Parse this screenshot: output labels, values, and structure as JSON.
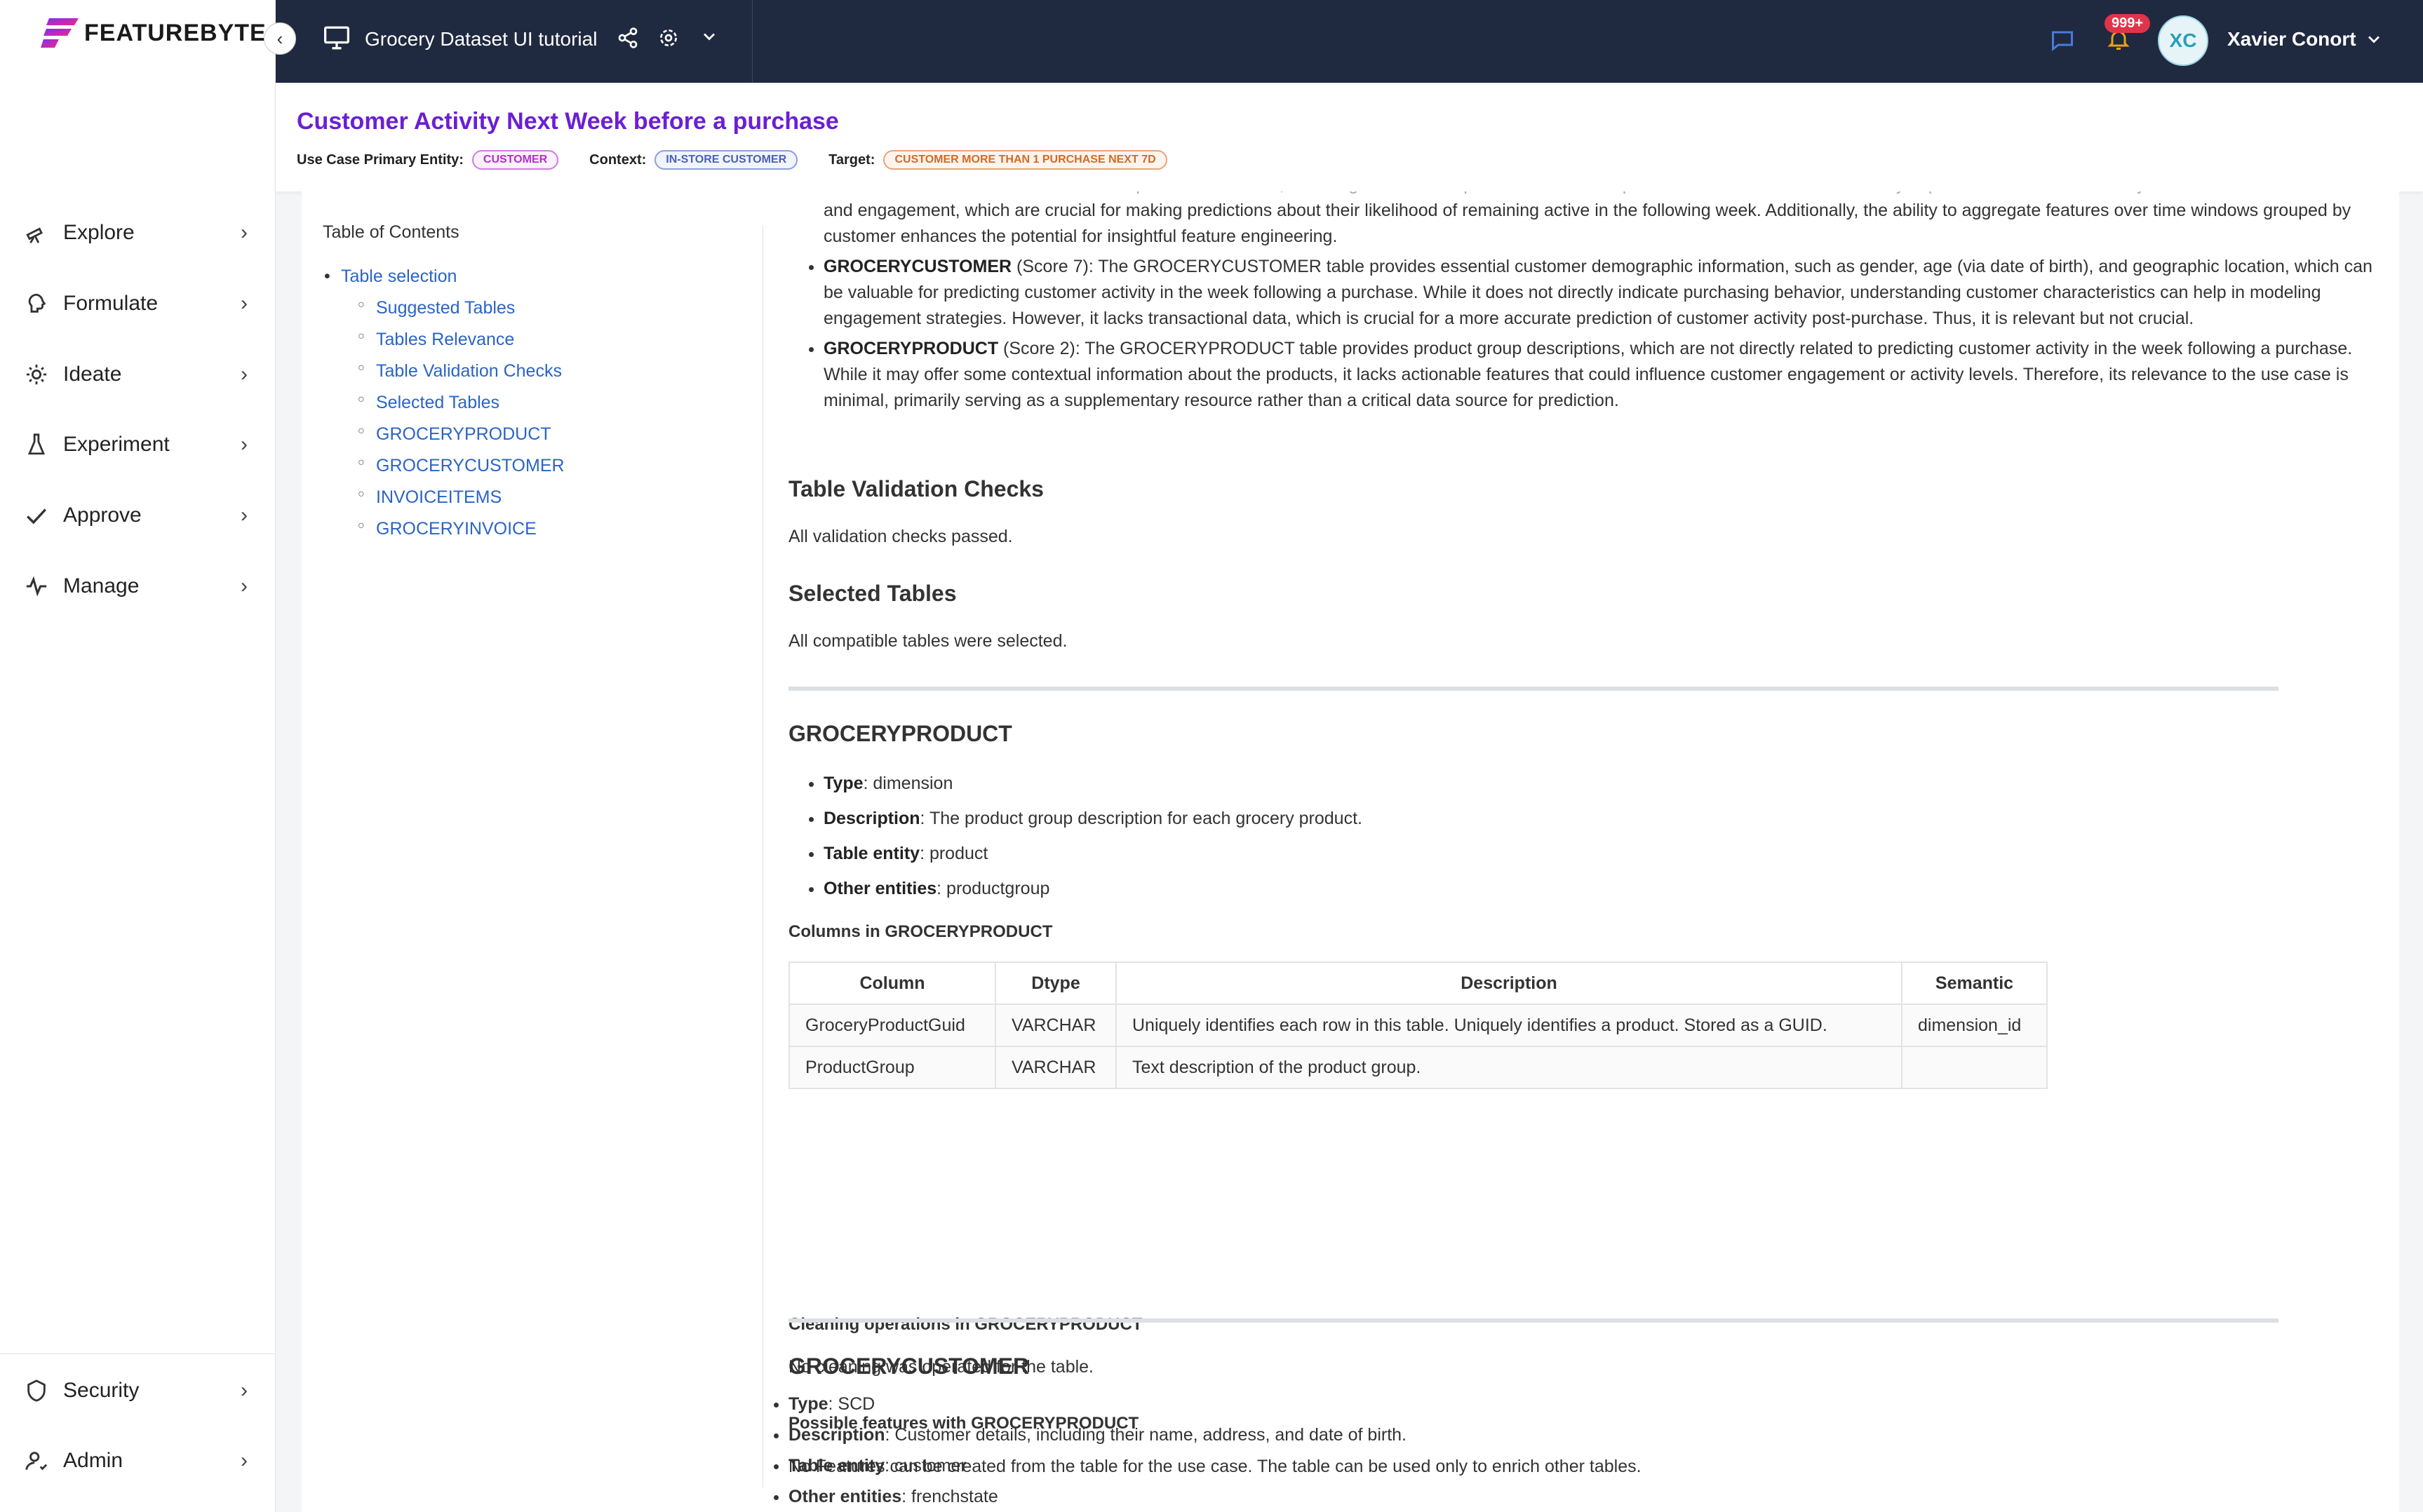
{
  "brand": {
    "name": "FEATUREBYTE"
  },
  "sidebar": {
    "items": [
      {
        "label": "Explore",
        "icon": "telescope-icon"
      },
      {
        "label": "Formulate",
        "icon": "brain-icon"
      },
      {
        "label": "Ideate",
        "icon": "lightbulb-icon"
      },
      {
        "label": "Experiment",
        "icon": "flask-icon"
      },
      {
        "label": "Approve",
        "icon": "check-icon"
      },
      {
        "label": "Manage",
        "icon": "pulse-icon"
      }
    ],
    "bottom_items": [
      {
        "label": "Security",
        "icon": "shield-icon"
      },
      {
        "label": "Admin",
        "icon": "user-admin-icon"
      }
    ]
  },
  "topbar": {
    "catalog_title": "Grocery Dataset UI tutorial",
    "notification_count": "999+",
    "user_initials": "XC",
    "user_name": "Xavier Conort"
  },
  "header": {
    "title": "Customer Activity Next Week before a purchase",
    "primary_entity_label": "Use Case Primary Entity:",
    "primary_entity_value": "CUSTOMER",
    "context_label": "Context:",
    "context_value": "IN-STORE CUSTOMER",
    "target_label": "Target:",
    "target_value": "CUSTOMER MORE THAN 1 PURCHASE NEXT 7D"
  },
  "toc": {
    "title": "Table of Contents",
    "top": "Table selection",
    "items": [
      "Suggested Tables",
      "Tables Relevance",
      "Table Validation Checks",
      "Selected Tables",
      "GROCERYPRODUCT",
      "GROCERYCUSTOMER",
      "INVOICEITEMS",
      "GROCERYINVOICE"
    ]
  },
  "doc": {
    "faded_line": "information about the customer's recent purchase behavior, including the timestamp and total amount spent. This data can be used to analyze patterns in customer activity",
    "para_cont": "and engagement, which are crucial for making predictions about their likelihood of remaining active in the following week. Additionally, the ability to aggregate features over time windows grouped by customer enhances the potential for insightful feature engineering.",
    "bullet_customer_name": "GROCERYCUSTOMER",
    "bullet_customer_text": " (Score 7): The GROCERYCUSTOMER table provides essential customer demographic information, such as gender, age (via date of birth), and geographic location, which can be valuable for predicting customer activity in the week following a purchase. While it does not directly indicate purchasing behavior, understanding customer characteristics can help in modeling engagement strategies. However, it lacks transactional data, which is crucial for a more accurate prediction of customer activity post-purchase. Thus, it is relevant but not crucial.",
    "bullet_product_name": "GROCERYPRODUCT",
    "bullet_product_text": " (Score 2): The GROCERYPRODUCT table provides product group descriptions, which are not directly related to predicting customer activity in the week following a purchase. While it may offer some contextual information about the products, it lacks actionable features that could influence customer engagement or activity levels. Therefore, its relevance to the use case is minimal, primarily serving as a supplementary resource rather than a critical data source for prediction.",
    "validation_heading": "Table Validation Checks",
    "validation_text": "All validation checks passed.",
    "selected_heading": "Selected Tables",
    "selected_text": "All compatible tables were selected.",
    "product": {
      "heading": "GROCERYPRODUCT",
      "type_label": "Type",
      "type_value": ": dimension",
      "desc_label": "Description",
      "desc_value": ": The product group description for each grocery product.",
      "entity_label": "Table entity",
      "entity_value": ": product",
      "other_label": "Other entities",
      "other_value": ": productgroup",
      "columns_heading": "Columns in GROCERYPRODUCT",
      "table_headers": [
        "Column",
        "Dtype",
        "Description",
        "Semantic"
      ],
      "rows": [
        [
          "GroceryProductGuid",
          "VARCHAR",
          "Uniquely identifies each row in this table. Uniquely identifies a product. Stored as a GUID.",
          "dimension_id"
        ],
        [
          "ProductGroup",
          "VARCHAR",
          "Text description of the product group.",
          ""
        ]
      ],
      "cleaning_heading": "Cleaning operations in GROCERYPRODUCT",
      "cleaning_text": "No cleaning was operated for the table.",
      "features_heading": "Possible features with GROCERYPRODUCT",
      "features_text": "No Features can be created from the table for the use case. The table can be used only to enrich other tables."
    },
    "customer": {
      "heading": "GROCERYCUSTOMER",
      "type_label": "Type",
      "type_value": ": SCD",
      "desc_label": "Description",
      "desc_value": ": Customer details, including their name, address, and date of birth.",
      "entity_label": "Table entity",
      "entity_value": ": customer",
      "other_label": "Other entities",
      "other_value": ": frenchstate"
    }
  },
  "colors": {
    "topbar": "#1f2940",
    "title": "#6b1fd4",
    "link": "#2a64c8"
  }
}
